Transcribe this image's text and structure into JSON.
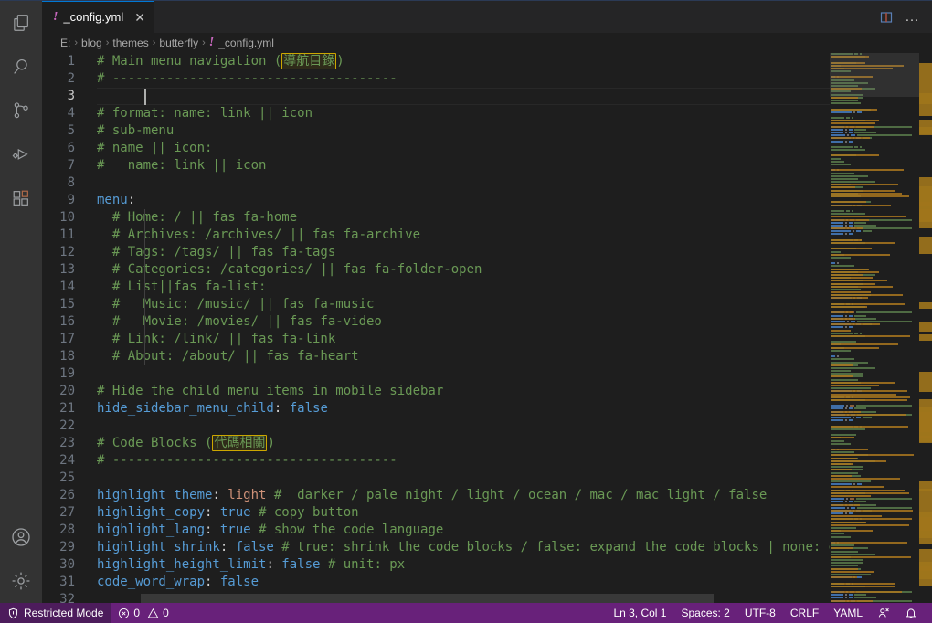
{
  "window": {
    "app": "Visual Studio Code",
    "theme_accent": "#0078d4",
    "statusbar_color": "#68217a"
  },
  "activity_bar": {
    "items": [
      {
        "name": "explorer",
        "icon": "files-icon",
        "title": "Explorer"
      },
      {
        "name": "search",
        "icon": "search-icon",
        "title": "Search"
      },
      {
        "name": "source-control",
        "icon": "source-control-icon",
        "title": "Source Control"
      },
      {
        "name": "run-debug",
        "icon": "run-and-debug-icon",
        "title": "Run and Debug"
      },
      {
        "name": "extensions",
        "icon": "extensions-icon",
        "title": "Extensions"
      }
    ],
    "bottom_items": [
      {
        "name": "account",
        "icon": "account-icon",
        "title": "Accounts"
      },
      {
        "name": "manage",
        "icon": "gear-icon",
        "title": "Manage"
      }
    ]
  },
  "tabs": [
    {
      "label": "_config.yml",
      "icon": "yaml-file-icon",
      "icon_glyph": "!",
      "active": true,
      "close_glyph": "✕"
    }
  ],
  "editor_actions": {
    "split_editor": "split-editor-icon",
    "more_actions": "…"
  },
  "breadcrumb": {
    "separator": "›",
    "items": [
      "E:",
      "blog",
      "themes",
      "butterfly"
    ],
    "file": "_config.yml",
    "file_icon_glyph": "!"
  },
  "code": {
    "language": "YAML",
    "active_line": 3,
    "first_line": 1,
    "lines": [
      {
        "n": 1,
        "tokens": [
          {
            "t": "# Main menu navigation (",
            "c": "c-comment"
          },
          {
            "t": "導航目錄",
            "c": "c-comment uni-hl"
          },
          {
            "t": ")",
            "c": "c-comment"
          }
        ]
      },
      {
        "n": 2,
        "tokens": [
          {
            "t": "# -------------------------------------",
            "c": "c-comment"
          }
        ]
      },
      {
        "n": 3,
        "tokens": [
          {
            "t": "",
            "c": "c-comment"
          }
        ]
      },
      {
        "n": 4,
        "tokens": [
          {
            "t": "# format: name: link || icon",
            "c": "c-comment"
          }
        ]
      },
      {
        "n": 5,
        "tokens": [
          {
            "t": "# sub-menu",
            "c": "c-comment"
          }
        ]
      },
      {
        "n": 6,
        "tokens": [
          {
            "t": "# name || icon:",
            "c": "c-comment"
          }
        ]
      },
      {
        "n": 7,
        "tokens": [
          {
            "t": "#   name: link || icon",
            "c": "c-comment"
          }
        ]
      },
      {
        "n": 8,
        "tokens": [
          {
            "t": "",
            "c": "c-comment"
          }
        ]
      },
      {
        "n": 9,
        "tokens": [
          {
            "t": "menu",
            "c": "c-key"
          },
          {
            "t": ":",
            "c": "c-punct"
          }
        ]
      },
      {
        "n": 10,
        "tokens": [
          {
            "t": "  # Home: / || fas fa-home",
            "c": "c-comment"
          }
        ]
      },
      {
        "n": 11,
        "tokens": [
          {
            "t": "  # Archives: /archives/ || fas fa-archive",
            "c": "c-comment"
          }
        ]
      },
      {
        "n": 12,
        "tokens": [
          {
            "t": "  # Tags: /tags/ || fas fa-tags",
            "c": "c-comment"
          }
        ]
      },
      {
        "n": 13,
        "tokens": [
          {
            "t": "  # Categories: /categories/ || fas fa-folder-open",
            "c": "c-comment"
          }
        ]
      },
      {
        "n": 14,
        "tokens": [
          {
            "t": "  # List||fas fa-list:",
            "c": "c-comment"
          }
        ]
      },
      {
        "n": 15,
        "tokens": [
          {
            "t": "  #   Music: /music/ || fas fa-music",
            "c": "c-comment"
          }
        ]
      },
      {
        "n": 16,
        "tokens": [
          {
            "t": "  #   Movie: /movies/ || fas fa-video",
            "c": "c-comment"
          }
        ]
      },
      {
        "n": 17,
        "tokens": [
          {
            "t": "  # Link: /link/ || fas fa-link",
            "c": "c-comment"
          }
        ]
      },
      {
        "n": 18,
        "tokens": [
          {
            "t": "  # About: /about/ || fas fa-heart",
            "c": "c-comment"
          }
        ]
      },
      {
        "n": 19,
        "tokens": [
          {
            "t": "",
            "c": "c-comment"
          }
        ]
      },
      {
        "n": 20,
        "tokens": [
          {
            "t": "# Hide the child menu items in mobile sidebar",
            "c": "c-comment"
          }
        ]
      },
      {
        "n": 21,
        "tokens": [
          {
            "t": "hide_sidebar_menu_child",
            "c": "c-key"
          },
          {
            "t": ": ",
            "c": "c-punct"
          },
          {
            "t": "false",
            "c": "c-bool"
          }
        ]
      },
      {
        "n": 22,
        "tokens": [
          {
            "t": "",
            "c": "c-comment"
          }
        ]
      },
      {
        "n": 23,
        "tokens": [
          {
            "t": "# Code Blocks (",
            "c": "c-comment"
          },
          {
            "t": "代碼相關",
            "c": "c-comment uni-hl"
          },
          {
            "t": ")",
            "c": "c-comment"
          }
        ]
      },
      {
        "n": 24,
        "tokens": [
          {
            "t": "# -------------------------------------",
            "c": "c-comment"
          }
        ]
      },
      {
        "n": 25,
        "tokens": [
          {
            "t": "",
            "c": "c-comment"
          }
        ]
      },
      {
        "n": 26,
        "tokens": [
          {
            "t": "highlight_theme",
            "c": "c-key"
          },
          {
            "t": ": ",
            "c": "c-punct"
          },
          {
            "t": "light",
            "c": "c-str"
          },
          {
            "t": " #  darker / pale night / light / ocean / mac / mac light / false",
            "c": "c-comment"
          }
        ]
      },
      {
        "n": 27,
        "tokens": [
          {
            "t": "highlight_copy",
            "c": "c-key"
          },
          {
            "t": ": ",
            "c": "c-punct"
          },
          {
            "t": "true",
            "c": "c-bool"
          },
          {
            "t": " # copy button",
            "c": "c-comment"
          }
        ]
      },
      {
        "n": 28,
        "tokens": [
          {
            "t": "highlight_lang",
            "c": "c-key"
          },
          {
            "t": ": ",
            "c": "c-punct"
          },
          {
            "t": "true",
            "c": "c-bool"
          },
          {
            "t": " # show the code language",
            "c": "c-comment"
          }
        ]
      },
      {
        "n": 29,
        "tokens": [
          {
            "t": "highlight_shrink",
            "c": "c-key"
          },
          {
            "t": ": ",
            "c": "c-punct"
          },
          {
            "t": "false",
            "c": "c-bool"
          },
          {
            "t": " # true: shrink the code blocks / false: expand the code blocks | none: expand",
            "c": "c-comment"
          }
        ]
      },
      {
        "n": 30,
        "tokens": [
          {
            "t": "highlight_height_limit",
            "c": "c-key"
          },
          {
            "t": ": ",
            "c": "c-punct"
          },
          {
            "t": "false",
            "c": "c-bool"
          },
          {
            "t": " # unit: px",
            "c": "c-comment"
          }
        ]
      },
      {
        "n": 31,
        "tokens": [
          {
            "t": "code_word_wrap",
            "c": "c-key"
          },
          {
            "t": ": ",
            "c": "c-punct"
          },
          {
            "t": "false",
            "c": "c-bool"
          }
        ]
      },
      {
        "n": 32,
        "tokens": [
          {
            "t": "",
            "c": "c-comment"
          }
        ]
      }
    ]
  },
  "statusbar": {
    "restricted_mode": {
      "label": "Restricted Mode",
      "icon": "shield-icon"
    },
    "problems": {
      "errors": "0",
      "warnings": "0",
      "error_icon": "error-circle-icon",
      "warning_icon": "warning-triangle-icon"
    },
    "position": "Ln 3, Col 1",
    "indentation": "Spaces: 2",
    "encoding": "UTF-8",
    "eol": "CRLF",
    "language": "YAML",
    "feedback_icon": "feedback-icon",
    "notifications_icon": "bell-icon"
  }
}
